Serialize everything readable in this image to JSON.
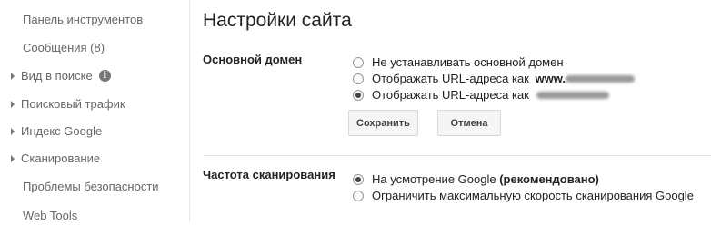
{
  "sidebar": {
    "items": [
      {
        "label": "Панель инструментов",
        "expandable": false
      },
      {
        "label": "Сообщения (8)",
        "expandable": false
      },
      {
        "label": "Вид в поиске",
        "expandable": true,
        "icon": "info-icon"
      },
      {
        "label": "Поисковый трафик",
        "expandable": true
      },
      {
        "label": "Индекс Google",
        "expandable": true
      },
      {
        "label": "Сканирование",
        "expandable": true
      },
      {
        "label": "Проблемы безопасности",
        "expandable": false
      },
      {
        "label": "Web Tools",
        "expandable": false
      }
    ],
    "info_icon_glyph": "i"
  },
  "main": {
    "title": "Настройки сайта",
    "preferred_domain": {
      "label": "Основной домен",
      "options": [
        {
          "label": "Не устанавливать основной домен",
          "checked": false
        },
        {
          "label": "Отображать URL-адреса как",
          "prefix": "www.",
          "domain_obscured": true,
          "checked": false
        },
        {
          "label": "Отображать URL-адреса как",
          "prefix": "",
          "domain_obscured": true,
          "checked": true
        }
      ],
      "save_label": "Сохранить",
      "cancel_label": "Отмена"
    },
    "crawl_rate": {
      "label": "Частота сканирования",
      "options": [
        {
          "label": "На усмотрение Google",
          "suffix_bold": "(рекомендовано)",
          "checked": true
        },
        {
          "label": "Ограничить максимальную скорость сканирования Google",
          "checked": false
        }
      ]
    }
  },
  "colors": {
    "divider": "#e5e5e5",
    "button_bg": "#f5f5f5",
    "text_dark": "#222222",
    "nav_text": "#666666"
  }
}
